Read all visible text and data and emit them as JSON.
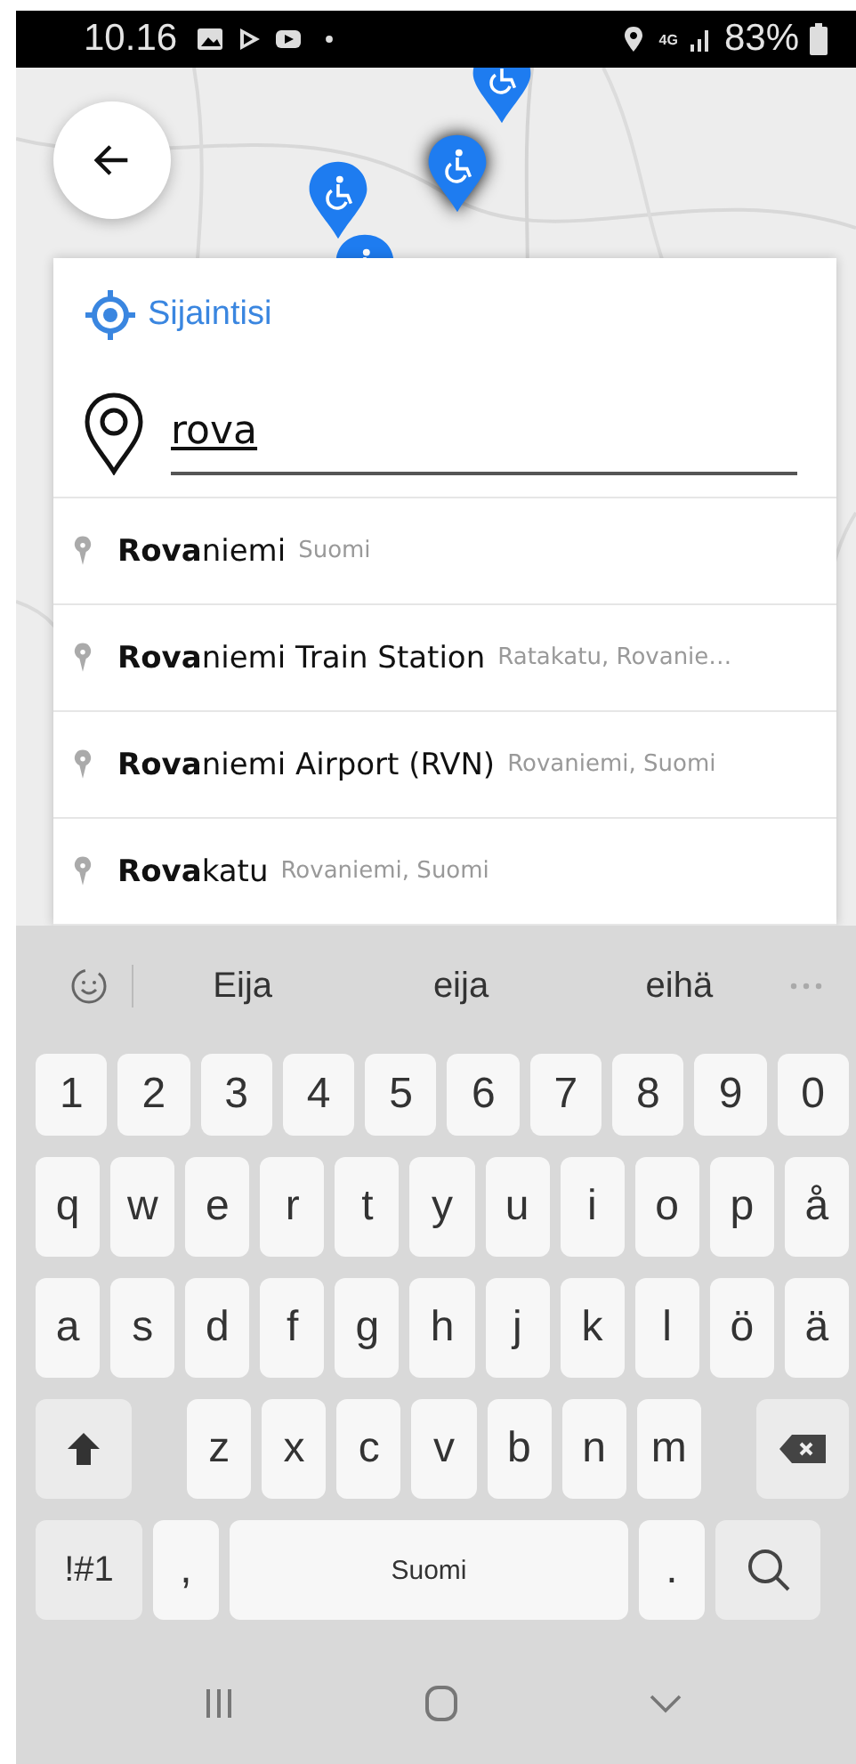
{
  "status_bar": {
    "time": "10.16",
    "network": "4G",
    "battery": "83%"
  },
  "search": {
    "location_label": "Sijaintisi",
    "value": "rova"
  },
  "suggestions": [
    {
      "name": "**Rova**niemi",
      "detail": "Suomi"
    },
    {
      "name": "**Rova**niemi Train Station",
      "detail": "Ratakatu, Rovanie…"
    },
    {
      "name": "**Rova**niemi Airport (RVN)",
      "detail": "Rovaniemi, Suomi"
    },
    {
      "name": "**Rova**katu",
      "detail": "Rovaniemi, Suomi"
    }
  ],
  "keyboard": {
    "predictions": [
      "Eija",
      "eija",
      "eihä"
    ],
    "number_row": [
      {
        "kind": "char",
        "label": "1"
      },
      {
        "kind": "char",
        "label": "2"
      },
      {
        "kind": "char",
        "label": "3"
      },
      {
        "kind": "char",
        "label": "4"
      },
      {
        "kind": "char",
        "label": "5"
      },
      {
        "kind": "char",
        "label": "6"
      },
      {
        "kind": "char",
        "label": "7"
      },
      {
        "kind": "char",
        "label": "8"
      },
      {
        "kind": "char",
        "label": "9"
      },
      {
        "kind": "char",
        "label": "0"
      }
    ],
    "top_row": [
      {
        "kind": "char",
        "label": "q"
      },
      {
        "kind": "char",
        "label": "w"
      },
      {
        "kind": "char",
        "label": "e"
      },
      {
        "kind": "char",
        "label": "r"
      },
      {
        "kind": "char",
        "label": "t"
      },
      {
        "kind": "char",
        "label": "y"
      },
      {
        "kind": "char",
        "label": "u"
      },
      {
        "kind": "char",
        "label": "i"
      },
      {
        "kind": "char",
        "label": "o"
      },
      {
        "kind": "char",
        "label": "p"
      },
      {
        "kind": "char",
        "label": "å"
      }
    ],
    "home_row": [
      {
        "kind": "char",
        "label": "a"
      },
      {
        "kind": "char",
        "label": "s"
      },
      {
        "kind": "char",
        "label": "d"
      },
      {
        "kind": "char",
        "label": "f"
      },
      {
        "kind": "char",
        "label": "g"
      },
      {
        "kind": "char",
        "label": "h"
      },
      {
        "kind": "char",
        "label": "j"
      },
      {
        "kind": "char",
        "label": "k"
      },
      {
        "kind": "char",
        "label": "l"
      },
      {
        "kind": "char",
        "label": "ö"
      },
      {
        "kind": "char",
        "label": "ä"
      }
    ],
    "bottom_row": [
      {
        "kind": "shift"
      },
      {
        "kind": "char",
        "label": "z"
      },
      {
        "kind": "char",
        "label": "x"
      },
      {
        "kind": "char",
        "label": "c"
      },
      {
        "kind": "char",
        "label": "v"
      },
      {
        "kind": "char",
        "label": "b"
      },
      {
        "kind": "char",
        "label": "n"
      },
      {
        "kind": "char",
        "label": "m"
      },
      {
        "kind": "backspace"
      }
    ],
    "function_row": [
      {
        "kind": "symbols",
        "label": "!#1"
      },
      {
        "kind": "punct",
        "label": ","
      },
      {
        "kind": "space",
        "label": "Suomi"
      },
      {
        "kind": "punct",
        "label": "."
      },
      {
        "kind": "search"
      }
    ]
  }
}
